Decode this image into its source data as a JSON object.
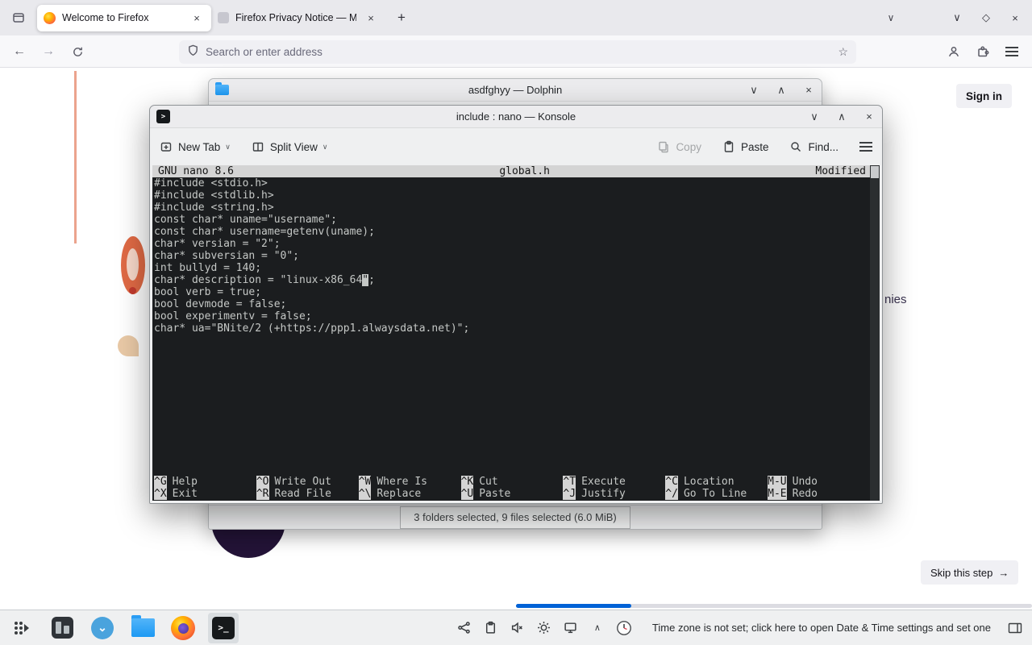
{
  "colors": {
    "accent": "#3daee9",
    "progress": "#0062d6"
  },
  "icons": {
    "close": "×",
    "minimize": "∨",
    "maximize": "∧",
    "restore": "◇",
    "new_tab_plus": "+",
    "tab_list_chevron": "∨",
    "back": "←",
    "forward": "→",
    "star": "☆",
    "dropdown": "∨",
    "tray_expand": "∧",
    "skip_arrow": "→",
    "discover_glyph": "⌄"
  },
  "firefox": {
    "tabs": [
      {
        "title": "Welcome to Firefox"
      },
      {
        "title": "Firefox Privacy Notice — M"
      }
    ],
    "urlbar_placeholder": "Search or enter address",
    "page": {
      "sign_in": "Sign in",
      "skip": "Skip this step",
      "fragment": "nies"
    }
  },
  "dolphin": {
    "title": "asdfghyy — Dolphin",
    "status": "3 folders selected, 9 files selected (6.0 MiB)"
  },
  "konsole": {
    "title": "include : nano — Konsole",
    "toolbar": {
      "new_tab": "New Tab",
      "split_view": "Split View",
      "copy": "Copy",
      "paste": "Paste",
      "find": "Find..."
    },
    "nano": {
      "app": "GNU nano 8.6",
      "file": "global.h",
      "state": "Modified",
      "lines_before": [
        "#include <stdio.h>",
        "#include <stdlib.h>",
        "#include <string.h>",
        "const char* uname=\"username\";",
        "const char* username=getenv(uname);",
        "char* versian = \"2\";",
        "char* subversian = \"0\";",
        "int bullyd = 140;"
      ],
      "cursor_line": {
        "pre": "char* description = \"linux-x86_64",
        "cursor": "\"",
        "post": ";"
      },
      "lines_after": [
        "bool verb = true;",
        "bool devmode = false;",
        "bool experimentv = false;",
        "char* ua=\"BNite/2 (+https://ppp1.alwaysdata.net)\";"
      ],
      "shortcuts": [
        {
          "key": "^G",
          "label": "Help"
        },
        {
          "key": "^O",
          "label": "Write Out"
        },
        {
          "key": "^W",
          "label": "Where Is"
        },
        {
          "key": "^K",
          "label": "Cut"
        },
        {
          "key": "^T",
          "label": "Execute"
        },
        {
          "key": "^C",
          "label": "Location"
        },
        {
          "key": "M-U",
          "label": "Undo"
        },
        {
          "key": "^X",
          "label": "Exit"
        },
        {
          "key": "^R",
          "label": "Read File"
        },
        {
          "key": "^\\",
          "label": "Replace"
        },
        {
          "key": "^U",
          "label": "Paste"
        },
        {
          "key": "^J",
          "label": "Justify"
        },
        {
          "key": "^/",
          "label": "Go To Line"
        },
        {
          "key": "M-E",
          "label": "Redo"
        }
      ]
    }
  },
  "taskbar": {
    "notification": "Time zone is not set; click here to open Date & Time settings and set one"
  }
}
